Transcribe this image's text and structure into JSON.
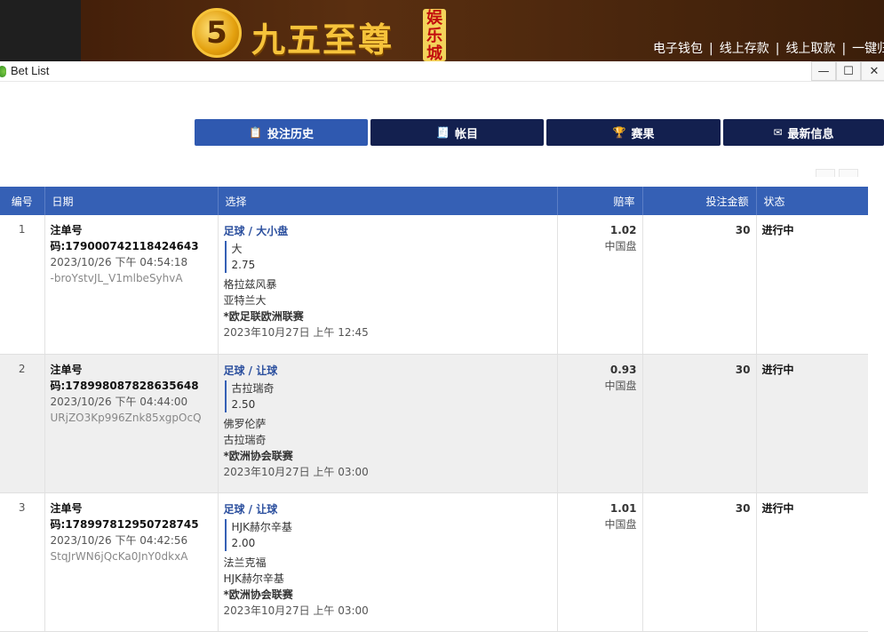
{
  "banner": {
    "logo_digit": "5",
    "logo_text": "九五至尊",
    "logo_badge": "娱乐城",
    "nav": [
      "电子钱包",
      "线上存款",
      "线上取款",
      "一键归户"
    ]
  },
  "window": {
    "title": "Bet List",
    "minimize": "—",
    "maximize": "☐",
    "close": "✕"
  },
  "tabs": [
    {
      "label": "投注历史",
      "icon": "📋"
    },
    {
      "label": "帐目",
      "icon": "🧾"
    },
    {
      "label": "赛果",
      "icon": "🏆"
    },
    {
      "label": "最新信息",
      "icon": "✉"
    }
  ],
  "table": {
    "headers": [
      "编号",
      "日期",
      "选择",
      "赔率",
      "投注金额",
      "状态"
    ],
    "rows": [
      {
        "no": "1",
        "slip": "注单号码:179000742118424643",
        "time": "2023/10/26 下午 04:54:18",
        "hash": "-broYstvJL_V1mlbeSyhvA",
        "market": "足球 / 大小盘",
        "pick": "大",
        "line": "2.75",
        "home": "格拉兹风暴",
        "away": "亚特兰大",
        "league": "*欧足联欧洲联赛",
        "kickoff": "2023年10月27日 上午 12:45",
        "odds": "1.02",
        "odds_type": "中国盘",
        "amount": "30",
        "status": "进行中"
      },
      {
        "no": "2",
        "slip": "注单号码:178998087828635648",
        "time": "2023/10/26 下午 04:44:00",
        "hash": "URjZO3Kp996Znk85xgpOcQ",
        "market": "足球 / 让球",
        "pick": "古拉瑞奇",
        "line": "2.50",
        "home": "佛罗伦萨",
        "away": "古拉瑞奇",
        "league": "*欧洲协会联赛",
        "kickoff": "2023年10月27日 上午 03:00",
        "odds": "0.93",
        "odds_type": "中国盘",
        "amount": "30",
        "status": "进行中"
      },
      {
        "no": "3",
        "slip": "注单号码:178997812950728745",
        "time": "2023/10/26 下午 04:42:56",
        "hash": "StqJrWN6jQcKa0JnY0dkxA",
        "market": "足球 / 让球",
        "pick": "HJK赫尔辛基",
        "line": "2.00",
        "home": "法兰克福",
        "away": "HJK赫尔辛基",
        "league": "*欧洲协会联赛",
        "kickoff": "2023年10月27日 上午 03:00",
        "odds": "1.01",
        "odds_type": "中国盘",
        "amount": "30",
        "status": "进行中"
      }
    ]
  }
}
